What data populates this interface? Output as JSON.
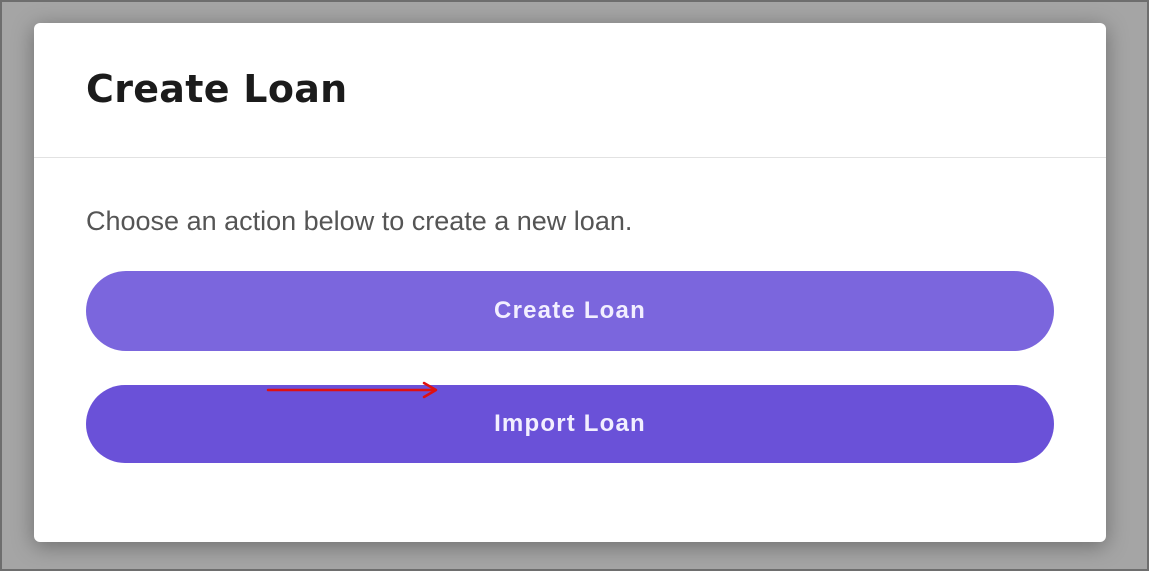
{
  "dialog": {
    "title": "Create Loan",
    "description": "Choose an action below to create a new loan.",
    "buttons": {
      "create_label": "Create Loan",
      "import_label": "Import Loan"
    },
    "colors": {
      "create_button": "#7b66dd",
      "import_button": "#6a51d8",
      "annotation_arrow": "#e01010"
    },
    "annotation": {
      "icon": "arrow-right-icon"
    }
  }
}
